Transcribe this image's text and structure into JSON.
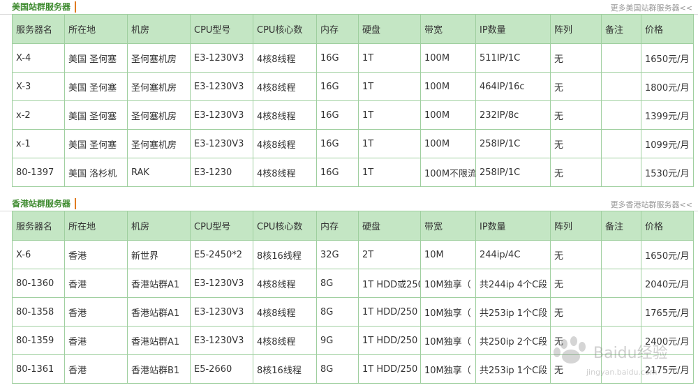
{
  "us": {
    "title": "美国站群服务器",
    "more": "更多美国站群服务器<<",
    "headers": [
      "服务器名",
      "所在地",
      "机房",
      "CPU型号",
      "CPU核心数",
      "内存",
      "硬盘",
      "带宽",
      "IP数量",
      "阵列",
      "备注",
      "价格"
    ],
    "rows": [
      [
        "X-4",
        "美国 圣何塞",
        "圣何塞机房",
        "E3-1230V3",
        "4核8线程",
        "16G",
        "1T",
        "100M",
        "511IP/1C",
        "无",
        "",
        "1650元/月"
      ],
      [
        "X-3",
        "美国 圣何塞",
        "圣何塞机房",
        "E3-1230V3",
        "4核8线程",
        "16G",
        "1T",
        "100M",
        "464IP/16c",
        "无",
        "",
        "1800元/月"
      ],
      [
        "x-2",
        "美国 圣何塞",
        "圣何塞机房",
        "E3-1230V3",
        "4核8线程",
        "16G",
        "1T",
        "100M",
        "232IP/8c",
        "无",
        "",
        "1399元/月"
      ],
      [
        "x-1",
        "美国 圣何塞",
        "圣何塞机房",
        "E3-1230V3",
        "4核8线程",
        "16G",
        "1T",
        "100M",
        "258IP/1C",
        "无",
        "",
        "1099元/月"
      ],
      [
        "80-1397",
        "美国 洛杉机",
        "RAK",
        "E3-1230",
        "4核8线程",
        "16G",
        "1T",
        "100M不限流",
        "258IP/1C",
        "无",
        "",
        "1530元/月"
      ]
    ]
  },
  "hk": {
    "title": "香港站群服务器",
    "more": "更多香港站群服务器<<",
    "headers": [
      "服务器名",
      "所在地",
      "机房",
      "CPU型号",
      "CPU核心数",
      "内存",
      "硬盘",
      "带宽",
      "IP数量",
      "阵列",
      "备注",
      "价格"
    ],
    "rows": [
      [
        "X-6",
        "香港",
        "新世界",
        "E5-2450*2",
        "8核16线程",
        "32G",
        "2T",
        "10M",
        "244ip/4C",
        "无",
        "",
        "1650元/月"
      ],
      [
        "80-1360",
        "香港",
        "香港站群A1",
        "E3-1230V3",
        "4核8线程",
        "8G",
        "1T HDD或250",
        "10M独享（",
        "共244ip 4个C段",
        "无",
        "",
        "2040元/月"
      ],
      [
        "80-1358",
        "香港",
        "香港站群A1",
        "E3-1230V3",
        "4核8线程",
        "8G",
        "1T HDD/250",
        "10M独享（",
        "共253ip 1个C段",
        "无",
        "",
        "1765元/月"
      ],
      [
        "80-1359",
        "香港",
        "香港站群A1",
        "E3-1230V3",
        "4核8线程",
        "9G",
        "1T HDD/250",
        "10M独享（",
        "共250ip 2个C段",
        "无",
        "",
        "2400元/月"
      ],
      [
        "80-1361",
        "香港",
        "香港站群B1",
        "E5-2660",
        "8核16线程",
        "8G",
        "1T HDD/250",
        "10M独享（",
        "共253ip 1个C段",
        "无",
        "",
        "2175元/月"
      ]
    ]
  },
  "watermark": {
    "brand": "Baidu经验",
    "url": "jingyan.baidu.com"
  }
}
